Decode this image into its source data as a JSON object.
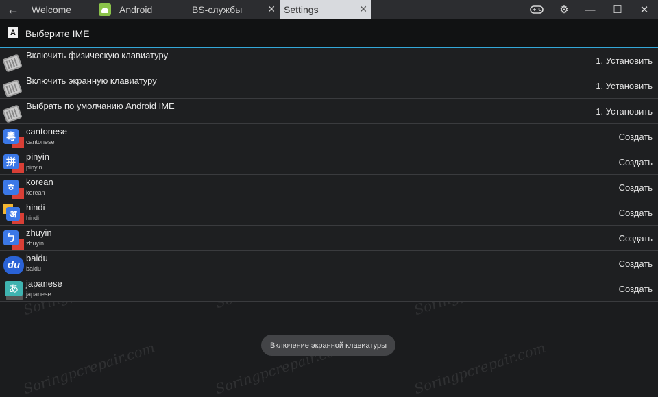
{
  "titlebar": {
    "tabs": [
      {
        "label": "Welcome"
      },
      {
        "label": "Android"
      },
      {
        "label": "BS-службы"
      },
      {
        "label": "Settings"
      }
    ]
  },
  "header": {
    "title": "Выберите IME",
    "icon_letter": "A"
  },
  "rows": [
    {
      "title": "Включить физическую клавиатуру",
      "sub": "",
      "action": "1. Установить",
      "icon": "keyboard-icon"
    },
    {
      "title": "Включить экранную клавиатуру",
      "sub": "",
      "action": "1. Установить",
      "icon": "keyboard-icon"
    },
    {
      "title": "Выбрать по умолчанию Android IME",
      "sub": "",
      "action": "1. Установить",
      "icon": "keyboard-icon"
    },
    {
      "title": "cantonese",
      "sub": "cantonese",
      "action": "Создать",
      "icon": "cantonese-ime-icon",
      "glyph": "粵"
    },
    {
      "title": "pinyin",
      "sub": "pinyin",
      "action": "Создать",
      "icon": "pinyin-ime-icon",
      "glyph": "拼"
    },
    {
      "title": "korean",
      "sub": "korean",
      "action": "Создать",
      "icon": "korean-ime-icon",
      "glyph": "ㅎ"
    },
    {
      "title": "hindi",
      "sub": "hindi",
      "action": "Создать",
      "icon": "hindi-ime-icon",
      "glyph": "अ"
    },
    {
      "title": "zhuyin",
      "sub": "zhuyin",
      "action": "Создать",
      "icon": "zhuyin-ime-icon",
      "glyph": "ㄅ"
    },
    {
      "title": "baidu",
      "sub": "baidu",
      "action": "Создать",
      "icon": "baidu-ime-icon",
      "glyph": "du"
    },
    {
      "title": "japanese",
      "sub": "japanese",
      "action": "Создать",
      "icon": "japanese-ime-icon",
      "glyph": "あ"
    }
  ],
  "toast": "Включение экранной клавиатуры",
  "watermark": "Soringpcrepair.com",
  "colors": {
    "accent": "#33a7d8",
    "background": "#1b1c1e",
    "active_tab": "#d8dade"
  }
}
